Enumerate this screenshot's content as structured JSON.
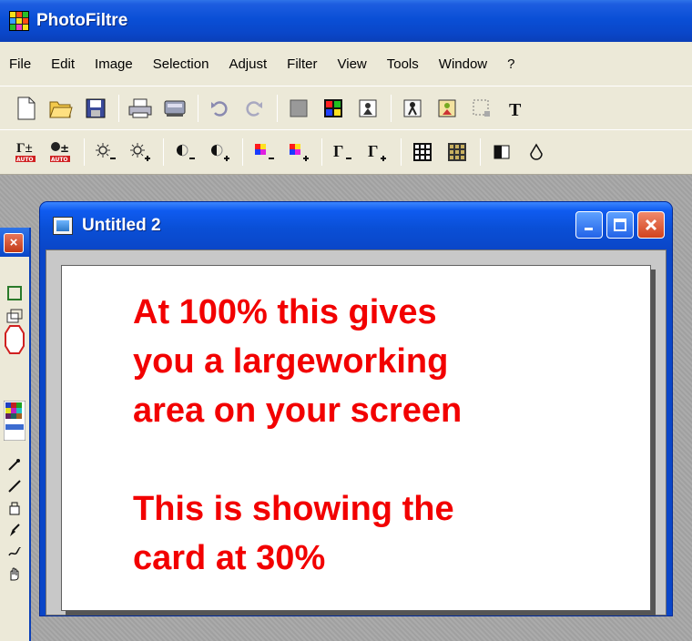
{
  "app": {
    "title": "PhotoFiltre"
  },
  "menubar": {
    "items": [
      "File",
      "Edit",
      "Image",
      "Selection",
      "Adjust",
      "Filter",
      "View",
      "Tools",
      "Window",
      "?"
    ]
  },
  "toolbar1": {
    "icons": [
      "new-file-icon",
      "open-folder-icon",
      "save-icon",
      "print-icon",
      "scan-icon",
      "undo-icon",
      "redo-icon",
      "gray-square-icon",
      "color-palette-icon",
      "image-icon",
      "figure-icon",
      "framed-figure-icon",
      "select-icon",
      "text-icon"
    ]
  },
  "toolbar2": {
    "icons": [
      "auto-levels-icon",
      "auto-contrast-icon",
      "brightness-minus-icon",
      "brightness-plus-icon",
      "contrast-minus-icon",
      "contrast-plus-icon",
      "saturation-minus-icon",
      "saturation-plus-icon",
      "gamma-minus-icon",
      "gamma-plus-icon",
      "grid-icon",
      "grid-color-icon",
      "half-square-icon",
      "drop-icon"
    ],
    "auto_label": "AUTO"
  },
  "document": {
    "title": "Untitled 2",
    "canvas_lines_1": [
      "At 100% this gives",
      "you a largeworking",
      "area on your screen"
    ],
    "canvas_lines_2": [
      "This is showing the",
      "card at 30%"
    ]
  },
  "colors": {
    "title_blue": "#0a46c8",
    "chrome": "#ece9d8",
    "workspace": "#a7a7a7",
    "canvas_text": "#f20000"
  }
}
